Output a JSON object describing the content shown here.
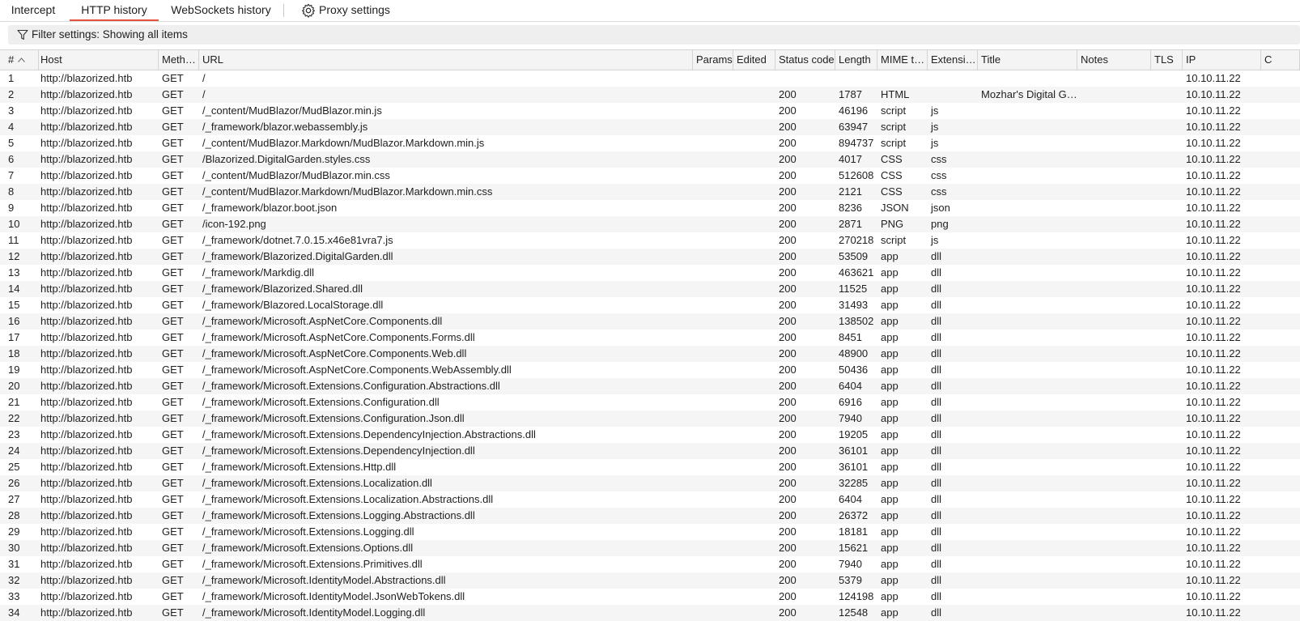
{
  "tabs": [
    {
      "label": "Intercept",
      "active": false
    },
    {
      "label": "HTTP history",
      "active": true
    },
    {
      "label": "WebSockets history",
      "active": false
    },
    {
      "label": "Proxy settings",
      "icon": "gear-icon",
      "active": false
    }
  ],
  "accent_color": "#e5533d",
  "filter": {
    "icon": "filter-icon",
    "text": "Filter settings: Showing all items"
  },
  "table": {
    "sort_indicator": "chevron-up-icon",
    "columns": [
      "#",
      "Host",
      "Meth…",
      "URL",
      "Params",
      "Edited",
      "Status code",
      "Length",
      "MIME t…",
      "Extensi…",
      "Title",
      "Notes",
      "TLS",
      "IP",
      "C"
    ],
    "rows": [
      [
        "1",
        "http://blazorized.htb",
        "GET",
        "/",
        "",
        "",
        "",
        "",
        "",
        "",
        "",
        "",
        "",
        "10.10.11.22",
        ""
      ],
      [
        "2",
        "http://blazorized.htb",
        "GET",
        "/",
        "",
        "",
        "200",
        "1787",
        "HTML",
        "",
        "Mozhar's Digital G…",
        "",
        "",
        "10.10.11.22",
        ""
      ],
      [
        "3",
        "http://blazorized.htb",
        "GET",
        "/_content/MudBlazor/MudBlazor.min.js",
        "",
        "",
        "200",
        "46196",
        "script",
        "js",
        "",
        "",
        "",
        "10.10.11.22",
        ""
      ],
      [
        "4",
        "http://blazorized.htb",
        "GET",
        "/_framework/blazor.webassembly.js",
        "",
        "",
        "200",
        "63947",
        "script",
        "js",
        "",
        "",
        "",
        "10.10.11.22",
        ""
      ],
      [
        "5",
        "http://blazorized.htb",
        "GET",
        "/_content/MudBlazor.Markdown/MudBlazor.Markdown.min.js",
        "",
        "",
        "200",
        "894737",
        "script",
        "js",
        "",
        "",
        "",
        "10.10.11.22",
        ""
      ],
      [
        "6",
        "http://blazorized.htb",
        "GET",
        "/Blazorized.DigitalGarden.styles.css",
        "",
        "",
        "200",
        "4017",
        "CSS",
        "css",
        "",
        "",
        "",
        "10.10.11.22",
        ""
      ],
      [
        "7",
        "http://blazorized.htb",
        "GET",
        "/_content/MudBlazor/MudBlazor.min.css",
        "",
        "",
        "200",
        "512608",
        "CSS",
        "css",
        "",
        "",
        "",
        "10.10.11.22",
        ""
      ],
      [
        "8",
        "http://blazorized.htb",
        "GET",
        "/_content/MudBlazor.Markdown/MudBlazor.Markdown.min.css",
        "",
        "",
        "200",
        "2121",
        "CSS",
        "css",
        "",
        "",
        "",
        "10.10.11.22",
        ""
      ],
      [
        "9",
        "http://blazorized.htb",
        "GET",
        "/_framework/blazor.boot.json",
        "",
        "",
        "200",
        "8236",
        "JSON",
        "json",
        "",
        "",
        "",
        "10.10.11.22",
        ""
      ],
      [
        "10",
        "http://blazorized.htb",
        "GET",
        "/icon-192.png",
        "",
        "",
        "200",
        "2871",
        "PNG",
        "png",
        "",
        "",
        "",
        "10.10.11.22",
        ""
      ],
      [
        "11",
        "http://blazorized.htb",
        "GET",
        "/_framework/dotnet.7.0.15.x46e81vra7.js",
        "",
        "",
        "200",
        "270218",
        "script",
        "js",
        "",
        "",
        "",
        "10.10.11.22",
        ""
      ],
      [
        "12",
        "http://blazorized.htb",
        "GET",
        "/_framework/Blazorized.DigitalGarden.dll",
        "",
        "",
        "200",
        "53509",
        "app",
        "dll",
        "",
        "",
        "",
        "10.10.11.22",
        ""
      ],
      [
        "13",
        "http://blazorized.htb",
        "GET",
        "/_framework/Markdig.dll",
        "",
        "",
        "200",
        "463621",
        "app",
        "dll",
        "",
        "",
        "",
        "10.10.11.22",
        ""
      ],
      [
        "14",
        "http://blazorized.htb",
        "GET",
        "/_framework/Blazorized.Shared.dll",
        "",
        "",
        "200",
        "11525",
        "app",
        "dll",
        "",
        "",
        "",
        "10.10.11.22",
        ""
      ],
      [
        "15",
        "http://blazorized.htb",
        "GET",
        "/_framework/Blazored.LocalStorage.dll",
        "",
        "",
        "200",
        "31493",
        "app",
        "dll",
        "",
        "",
        "",
        "10.10.11.22",
        ""
      ],
      [
        "16",
        "http://blazorized.htb",
        "GET",
        "/_framework/Microsoft.AspNetCore.Components.dll",
        "",
        "",
        "200",
        "138502",
        "app",
        "dll",
        "",
        "",
        "",
        "10.10.11.22",
        ""
      ],
      [
        "17",
        "http://blazorized.htb",
        "GET",
        "/_framework/Microsoft.AspNetCore.Components.Forms.dll",
        "",
        "",
        "200",
        "8451",
        "app",
        "dll",
        "",
        "",
        "",
        "10.10.11.22",
        ""
      ],
      [
        "18",
        "http://blazorized.htb",
        "GET",
        "/_framework/Microsoft.AspNetCore.Components.Web.dll",
        "",
        "",
        "200",
        "48900",
        "app",
        "dll",
        "",
        "",
        "",
        "10.10.11.22",
        ""
      ],
      [
        "19",
        "http://blazorized.htb",
        "GET",
        "/_framework/Microsoft.AspNetCore.Components.WebAssembly.dll",
        "",
        "",
        "200",
        "50436",
        "app",
        "dll",
        "",
        "",
        "",
        "10.10.11.22",
        ""
      ],
      [
        "20",
        "http://blazorized.htb",
        "GET",
        "/_framework/Microsoft.Extensions.Configuration.Abstractions.dll",
        "",
        "",
        "200",
        "6404",
        "app",
        "dll",
        "",
        "",
        "",
        "10.10.11.22",
        ""
      ],
      [
        "21",
        "http://blazorized.htb",
        "GET",
        "/_framework/Microsoft.Extensions.Configuration.dll",
        "",
        "",
        "200",
        "6916",
        "app",
        "dll",
        "",
        "",
        "",
        "10.10.11.22",
        ""
      ],
      [
        "22",
        "http://blazorized.htb",
        "GET",
        "/_framework/Microsoft.Extensions.Configuration.Json.dll",
        "",
        "",
        "200",
        "7940",
        "app",
        "dll",
        "",
        "",
        "",
        "10.10.11.22",
        ""
      ],
      [
        "23",
        "http://blazorized.htb",
        "GET",
        "/_framework/Microsoft.Extensions.DependencyInjection.Abstractions.dll",
        "",
        "",
        "200",
        "19205",
        "app",
        "dll",
        "",
        "",
        "",
        "10.10.11.22",
        ""
      ],
      [
        "24",
        "http://blazorized.htb",
        "GET",
        "/_framework/Microsoft.Extensions.DependencyInjection.dll",
        "",
        "",
        "200",
        "36101",
        "app",
        "dll",
        "",
        "",
        "",
        "10.10.11.22",
        ""
      ],
      [
        "25",
        "http://blazorized.htb",
        "GET",
        "/_framework/Microsoft.Extensions.Http.dll",
        "",
        "",
        "200",
        "36101",
        "app",
        "dll",
        "",
        "",
        "",
        "10.10.11.22",
        ""
      ],
      [
        "26",
        "http://blazorized.htb",
        "GET",
        "/_framework/Microsoft.Extensions.Localization.dll",
        "",
        "",
        "200",
        "32285",
        "app",
        "dll",
        "",
        "",
        "",
        "10.10.11.22",
        ""
      ],
      [
        "27",
        "http://blazorized.htb",
        "GET",
        "/_framework/Microsoft.Extensions.Localization.Abstractions.dll",
        "",
        "",
        "200",
        "6404",
        "app",
        "dll",
        "",
        "",
        "",
        "10.10.11.22",
        ""
      ],
      [
        "28",
        "http://blazorized.htb",
        "GET",
        "/_framework/Microsoft.Extensions.Logging.Abstractions.dll",
        "",
        "",
        "200",
        "26372",
        "app",
        "dll",
        "",
        "",
        "",
        "10.10.11.22",
        ""
      ],
      [
        "29",
        "http://blazorized.htb",
        "GET",
        "/_framework/Microsoft.Extensions.Logging.dll",
        "",
        "",
        "200",
        "18181",
        "app",
        "dll",
        "",
        "",
        "",
        "10.10.11.22",
        ""
      ],
      [
        "30",
        "http://blazorized.htb",
        "GET",
        "/_framework/Microsoft.Extensions.Options.dll",
        "",
        "",
        "200",
        "15621",
        "app",
        "dll",
        "",
        "",
        "",
        "10.10.11.22",
        ""
      ],
      [
        "31",
        "http://blazorized.htb",
        "GET",
        "/_framework/Microsoft.Extensions.Primitives.dll",
        "",
        "",
        "200",
        "7940",
        "app",
        "dll",
        "",
        "",
        "",
        "10.10.11.22",
        ""
      ],
      [
        "32",
        "http://blazorized.htb",
        "GET",
        "/_framework/Microsoft.IdentityModel.Abstractions.dll",
        "",
        "",
        "200",
        "5379",
        "app",
        "dll",
        "",
        "",
        "",
        "10.10.11.22",
        ""
      ],
      [
        "33",
        "http://blazorized.htb",
        "GET",
        "/_framework/Microsoft.IdentityModel.JsonWebTokens.dll",
        "",
        "",
        "200",
        "124198",
        "app",
        "dll",
        "",
        "",
        "",
        "10.10.11.22",
        ""
      ],
      [
        "34",
        "http://blazorized.htb",
        "GET",
        "/_framework/Microsoft.IdentityModel.Logging.dll",
        "",
        "",
        "200",
        "12548",
        "app",
        "dll",
        "",
        "",
        "",
        "10.10.11.22",
        ""
      ]
    ]
  }
}
